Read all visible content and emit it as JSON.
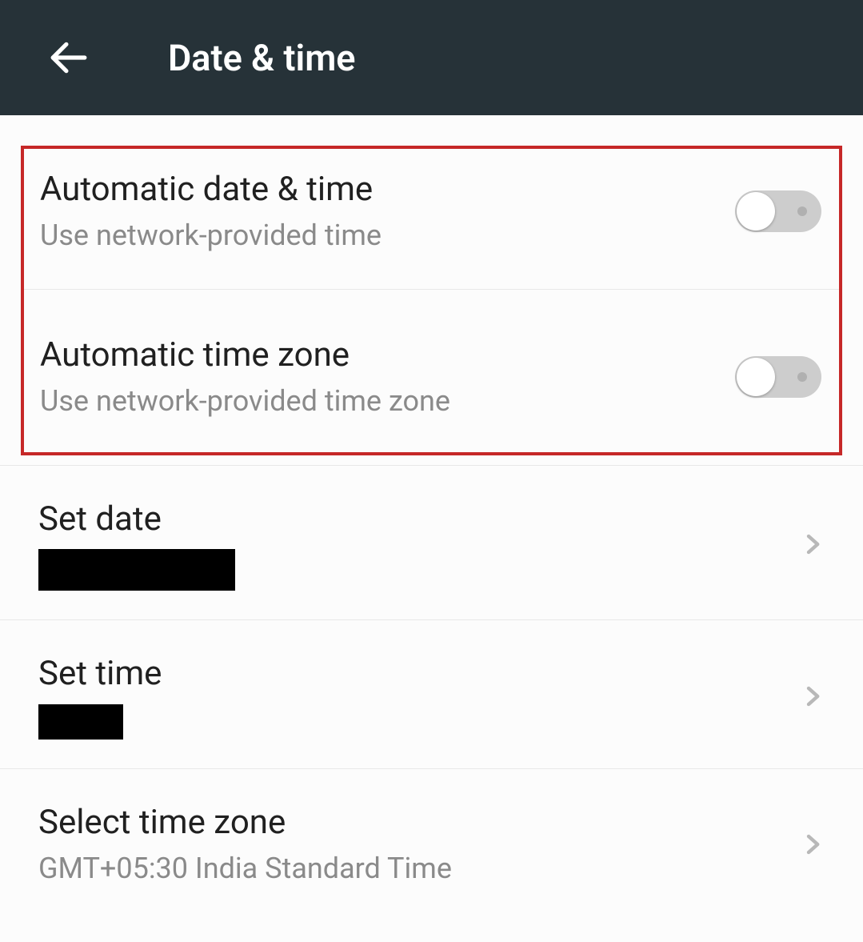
{
  "header": {
    "title": "Date & time"
  },
  "settings": {
    "auto_date_time": {
      "title": "Automatic date & time",
      "subtitle": "Use network-provided time",
      "enabled": false
    },
    "auto_time_zone": {
      "title": "Automatic time zone",
      "subtitle": "Use network-provided time zone",
      "enabled": false
    },
    "set_date": {
      "title": "Set date"
    },
    "set_time": {
      "title": "Set time"
    },
    "select_time_zone": {
      "title": "Select time zone",
      "subtitle": "GMT+05:30 India Standard Time"
    }
  }
}
